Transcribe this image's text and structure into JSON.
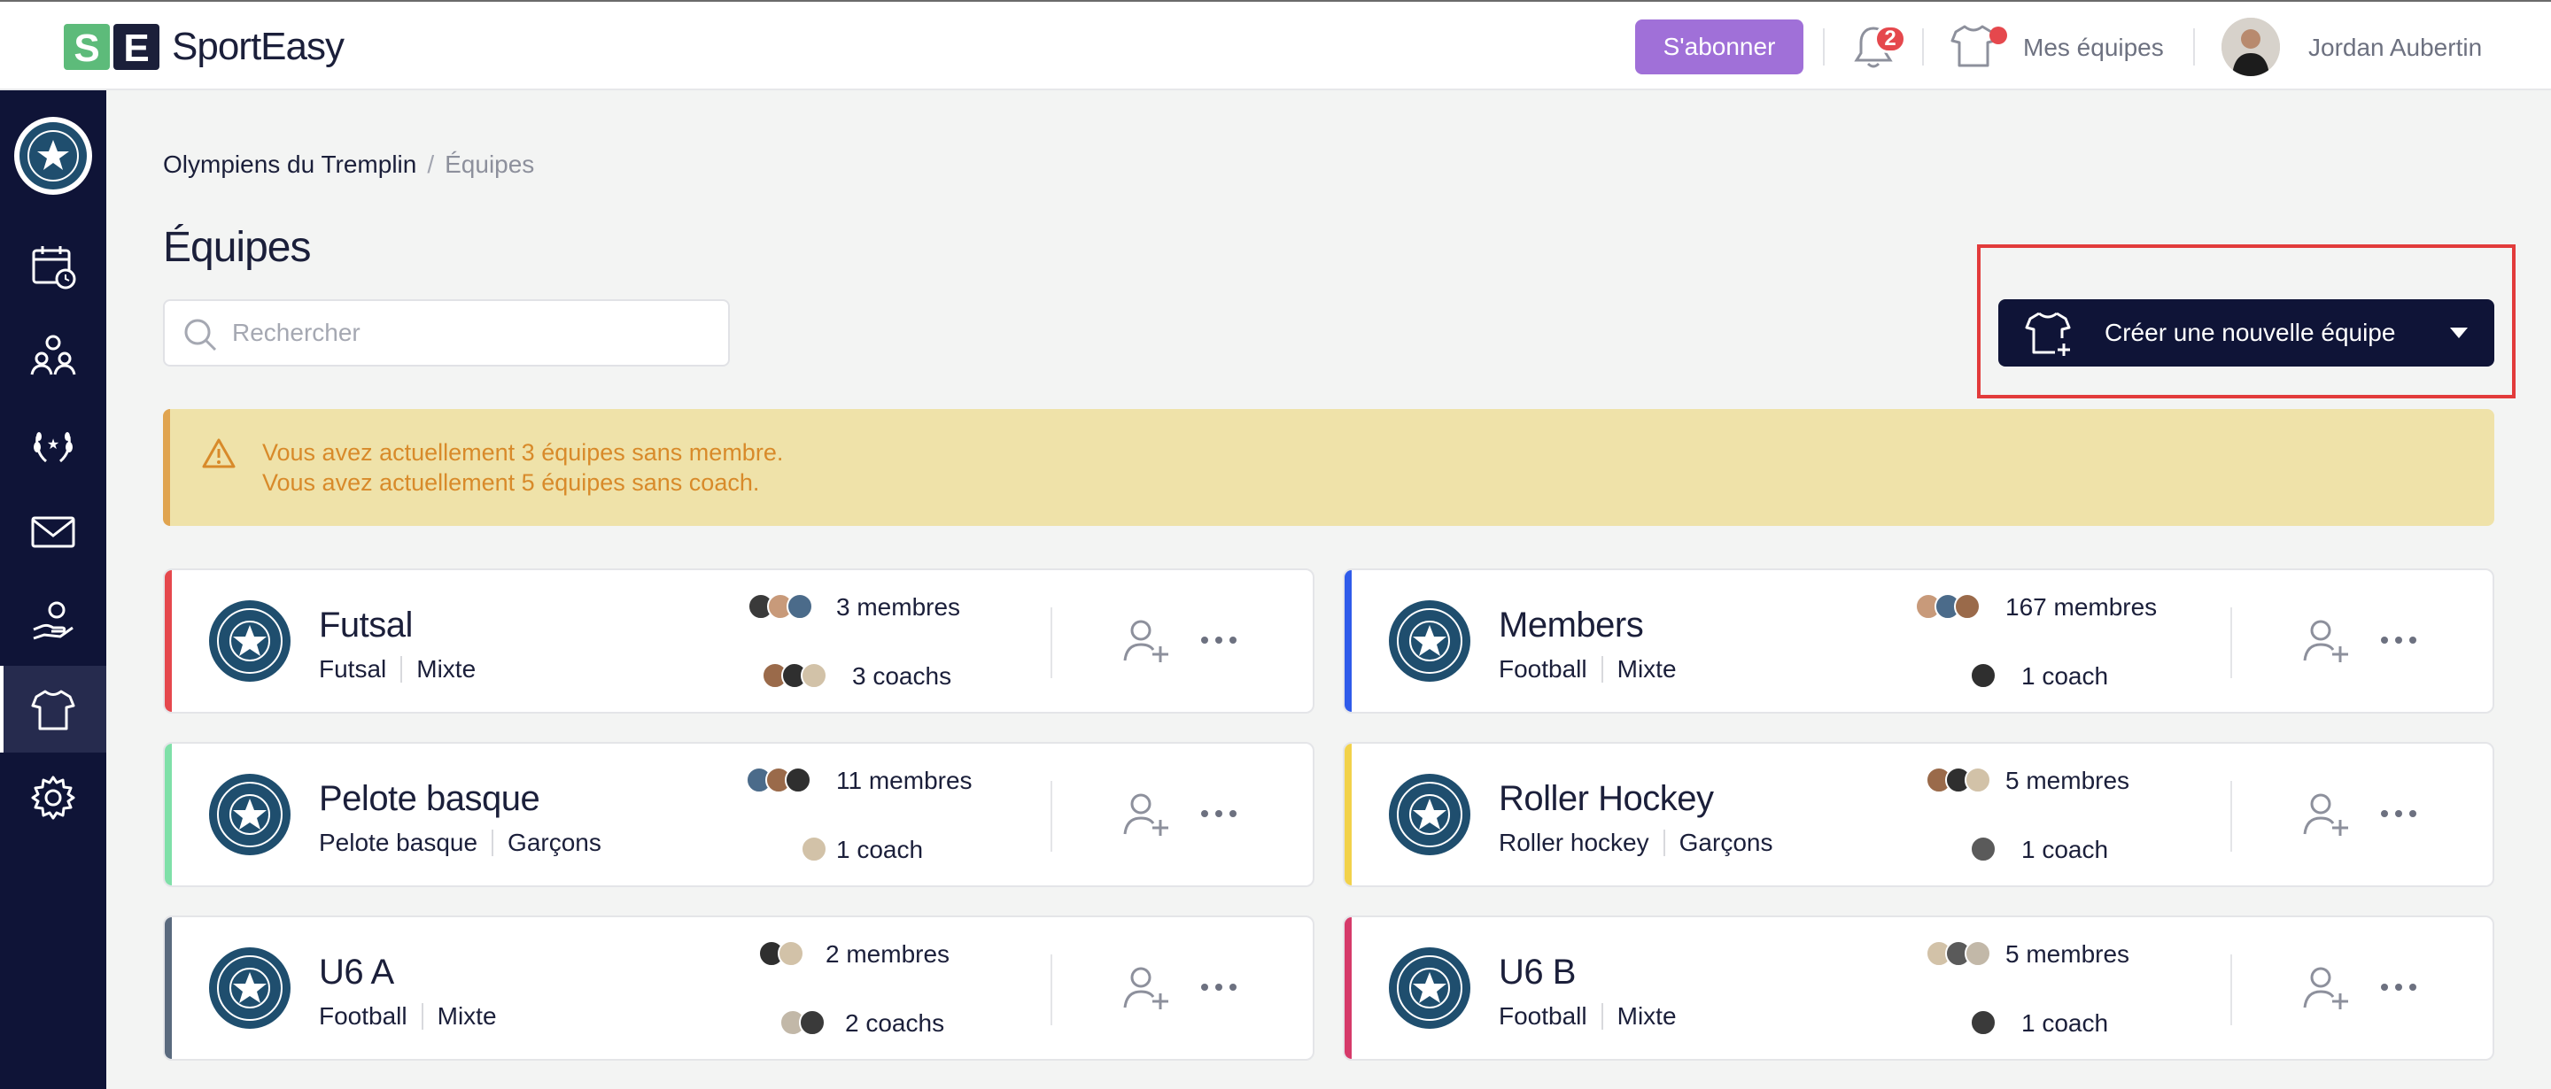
{
  "app": {
    "brand": "SportEasy"
  },
  "topbar": {
    "subscribe_label": "S'abonner",
    "notifications_count": "2",
    "my_teams_label": "Mes équipes",
    "user_name": "Jordan Aubertin"
  },
  "breadcrumb": {
    "club": "Olympiens du Tremplin",
    "separator": "/",
    "current": "Équipes"
  },
  "page": {
    "title": "Équipes"
  },
  "search": {
    "placeholder": "Rechercher",
    "value": ""
  },
  "create_button": {
    "label": "Créer une nouvelle équipe"
  },
  "alert": {
    "line1": "Vous avez actuellement 3 équipes sans membre.",
    "line2": "Vous avez actuellement 5 équipes sans coach."
  },
  "colors": {
    "sidebar": "#0f1437",
    "subscribe": "#a070d8",
    "alert_bg": "#efe2a9",
    "alert_text": "#d88a2a"
  },
  "sidebar_icons": [
    "club-logo",
    "calendar-icon",
    "members-icon",
    "laurel-icon",
    "mail-icon",
    "hand-icon",
    "shirt-icon",
    "settings-icon"
  ],
  "teams": [
    {
      "name": "Futsal",
      "sport": "Futsal",
      "gender": "Mixte",
      "members": "3 membres",
      "coaches": "3 coachs",
      "accent": "#e5484d"
    },
    {
      "name": "Members",
      "sport": "Football",
      "gender": "Mixte",
      "members": "167 membres",
      "coaches": "1 coach",
      "accent": "#2f5bea"
    },
    {
      "name": "Pelote basque",
      "sport": "Pelote basque",
      "gender": "Garçons",
      "members": "11 membres",
      "coaches": "1 coach",
      "accent": "#7fe0a8"
    },
    {
      "name": "Roller Hockey",
      "sport": "Roller hockey",
      "gender": "Garçons",
      "members": "5 membres",
      "coaches": "1 coach",
      "accent": "#f2d24a"
    },
    {
      "name": "U6 A",
      "sport": "Football",
      "gender": "Mixte",
      "members": "2 membres",
      "coaches": "2 coachs",
      "accent": "#5a6a7e"
    },
    {
      "name": "U6 B",
      "sport": "Football",
      "gender": "Mixte",
      "members": "5 membres",
      "coaches": "1 coach",
      "accent": "#d63a6a"
    }
  ]
}
